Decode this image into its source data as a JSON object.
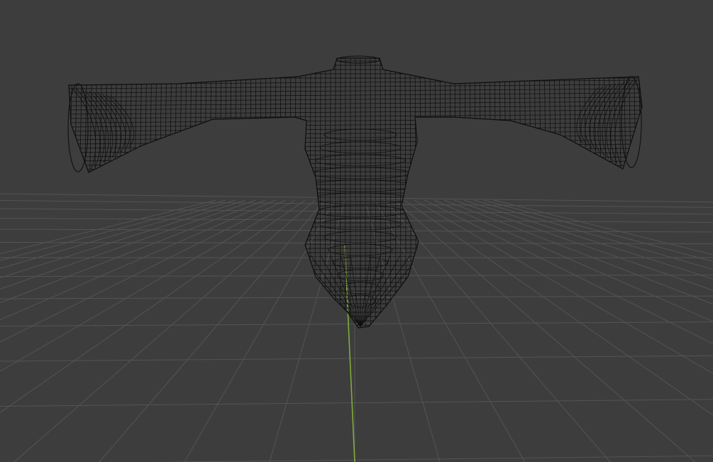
{
  "viewport": {
    "mode": "wireframe",
    "background_color": "#3d3d3d",
    "grid_color": "#545454",
    "wire_color": "#0d0d0d",
    "y_axis_color": "#7fad3a"
  },
  "scene": {
    "objects": [
      {
        "name": "garment-mesh",
        "shape": "bodysuit with outstretched sleeves"
      }
    ],
    "axes": [
      {
        "name": "y-axis",
        "color": "#7fad3a"
      }
    ]
  }
}
